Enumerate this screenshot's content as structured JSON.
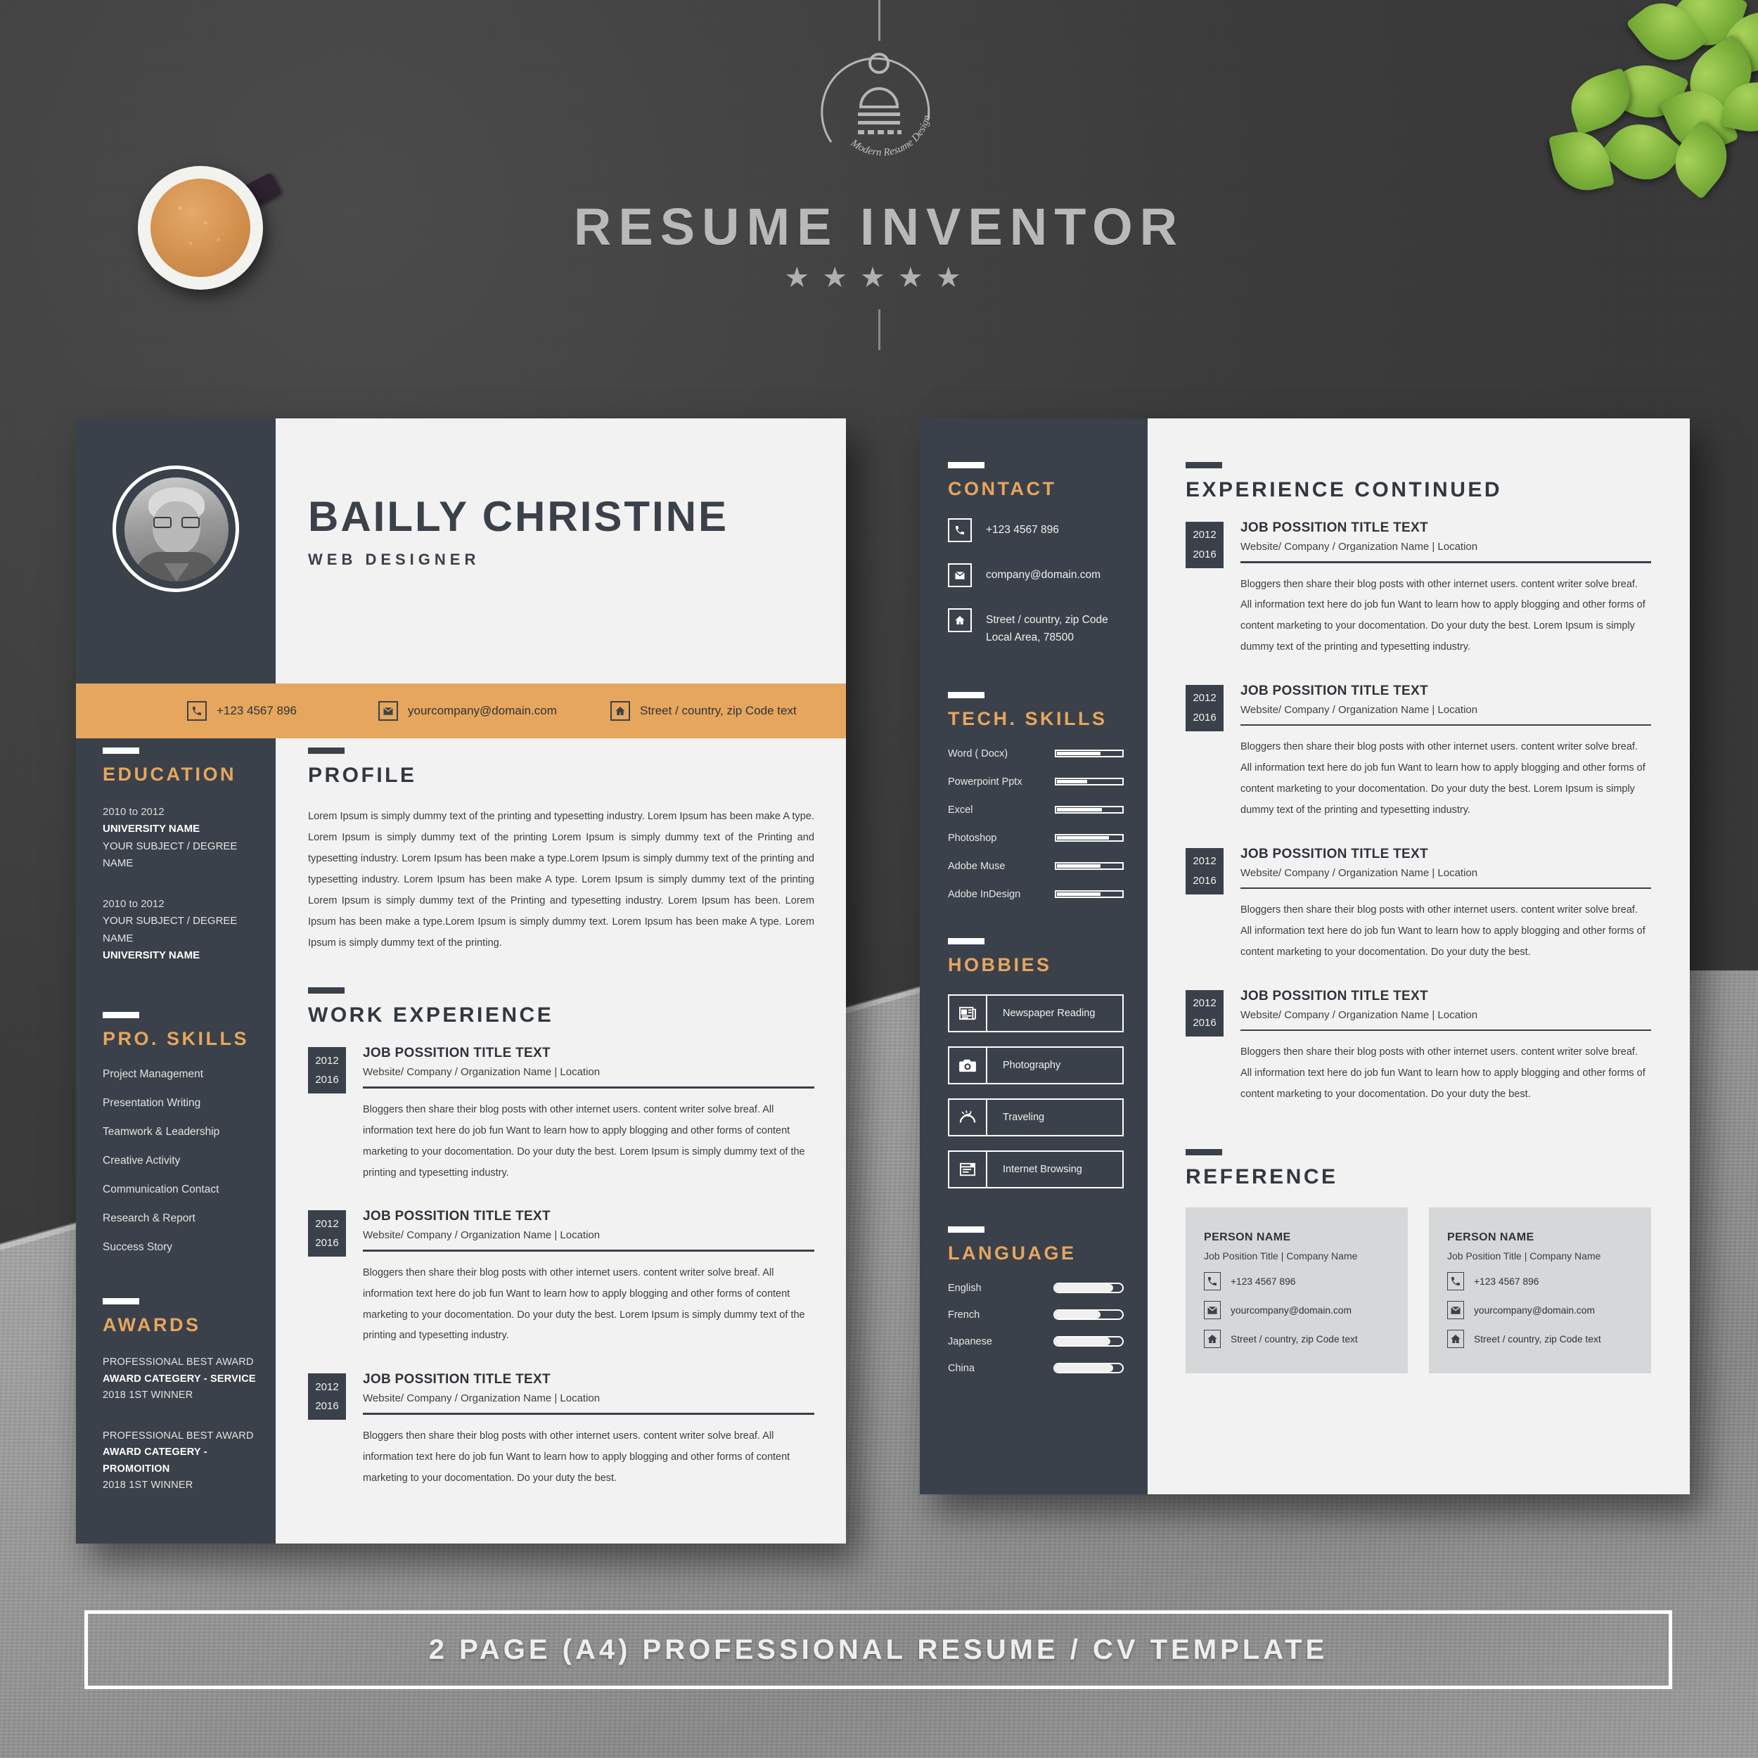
{
  "brand": {
    "title": "RESUME INVENTOR",
    "stars": "★★★★★",
    "logo_caption": "Modern Resume Design"
  },
  "banner": {
    "text": "2 PAGE (A4) PROFESSIONAL RESUME / CV TEMPLATE"
  },
  "page_left": {
    "name": "BAILLY CHRISTINE",
    "role": "WEB DESIGNER",
    "topbar": [
      {
        "icon": "phone-icon",
        "text": "+123 4567 896"
      },
      {
        "icon": "envelope-icon",
        "text": "yourcompany@domain.com"
      },
      {
        "icon": "home-icon",
        "text": "Street / country, zip Code text"
      }
    ],
    "education": {
      "heading": "EDUCATION",
      "items": [
        {
          "years": "2010 to 2012",
          "line2": "UNIVERSITY NAME",
          "line3": "YOUR SUBJECT / DEGREE NAME",
          "bold_first": true
        },
        {
          "years": "2010 to 2012",
          "line2": "YOUR SUBJECT / DEGREE NAME",
          "line3": "UNIVERSITY NAME",
          "bold_first": false
        }
      ]
    },
    "pro_skills": {
      "heading": "PRO. SKILLS",
      "items": [
        "Project Management",
        "Presentation Writing",
        "Teamwork & Leadership",
        "Creative Activity",
        "Communication Contact",
        "Research & Report",
        "Success Story"
      ]
    },
    "awards": {
      "heading": "AWARDS",
      "items": [
        {
          "line1": "PROFESSIONAL BEST AWARD",
          "line2": "AWARD CATEGERY - SERVICE",
          "line3": "2018 1ST WINNER"
        },
        {
          "line1": "PROFESSIONAL BEST AWARD",
          "line2": "AWARD CATEGERY - PROMOITION",
          "line3": "2018 1ST WINNER"
        }
      ]
    },
    "profile": {
      "heading": "PROFILE",
      "text": "Lorem Ipsum is simply dummy text of the printing and typesetting industry. Lorem Ipsum has been make A type. Lorem Ipsum is simply dummy text of the printing Lorem Ipsum is simply dummy text of the Printing and typesetting industry. Lorem Ipsum has been make a type.Lorem Ipsum is simply dummy text of the printing and typesetting industry. Lorem Ipsum has been make A type. Lorem Ipsum is simply dummy text of the printing Lorem Ipsum is simply dummy text of the Printing and typesetting industry. Lorem Ipsum has been. Lorem Ipsum has been make a type.Lorem Ipsum is simply dummy text. Lorem Ipsum has been make A type. Lorem Ipsum is simply dummy text of the printing."
    },
    "work_experience": {
      "heading": "WORK EXPERIENCE",
      "items": [
        {
          "year_from": "2012",
          "year_to": "2016",
          "title": "JOB POSSITION TITLE TEXT",
          "meta": "Website/ Company / Organization Name  |  Location",
          "desc": "Bloggers then share their blog posts with other internet users. content writer solve breaf. All information text here do job fun   Want to learn how to apply blogging and other forms of content marketing to your docomentation. Do your duty the best. Lorem Ipsum is simply dummy text of the printing and typesetting industry."
        },
        {
          "year_from": "2012",
          "year_to": "2016",
          "title": "JOB POSSITION TITLE TEXT",
          "meta": "Website/ Company / Organization Name  |  Location",
          "desc": "Bloggers then share their blog posts with other internet users. content writer solve breaf. All information text here do job fun   Want to learn how to apply blogging and other forms of content marketing to your docomentation. Do your duty the best. Lorem Ipsum is simply dummy text of the printing and typesetting industry."
        },
        {
          "year_from": "2012",
          "year_to": "2016",
          "title": "JOB POSSITION TITLE TEXT",
          "meta": "Website/ Company / Organization Name  |  Location",
          "desc": "Bloggers then share their blog posts with other internet users. content writer solve breaf. All information text here do job fun   Want to learn how to apply blogging and other forms of content marketing to your docomentation. Do your duty the best."
        }
      ]
    }
  },
  "page_right": {
    "contact": {
      "heading": "CONTACT",
      "items": [
        {
          "icon": "phone-icon",
          "text": "+123 4567 896"
        },
        {
          "icon": "envelope-icon",
          "text": "company@domain.com"
        },
        {
          "icon": "home-icon",
          "text": "Street / country, zip Code\nLocal Area, 78500"
        }
      ]
    },
    "tech_skills": {
      "heading": "TECH. SKILLS",
      "items": [
        {
          "label": "Word ( Docx)",
          "level": 72
        },
        {
          "label": "Powerpoint Pptx",
          "level": 50
        },
        {
          "label": "Excel",
          "level": 74
        },
        {
          "label": "Photoshop",
          "level": 85
        },
        {
          "label": "Adobe Muse",
          "level": 72
        },
        {
          "label": "Adobe InDesign",
          "level": 72
        }
      ]
    },
    "hobbies": {
      "heading": "HOBBIES",
      "items": [
        {
          "icon": "newspaper-icon",
          "label": "Newspaper Reading"
        },
        {
          "icon": "camera-icon",
          "label": "Photography"
        },
        {
          "icon": "airplane-icon",
          "label": "Traveling"
        },
        {
          "icon": "browser-icon",
          "label": "Internet Browsing"
        }
      ]
    },
    "language": {
      "heading": "LANGUAGE",
      "items": [
        {
          "label": "English",
          "level": 86
        },
        {
          "label": "French",
          "level": 68
        },
        {
          "label": "Japanese",
          "level": 82
        },
        {
          "label": "China",
          "level": 86
        }
      ]
    },
    "experience_continued": {
      "heading": "EXPERIENCE CONTINUED",
      "items": [
        {
          "year_from": "2012",
          "year_to": "2016",
          "title": "JOB POSSITION TITLE TEXT",
          "meta": "Website/ Company / Organization Name  |  Location",
          "desc": "Bloggers then share their blog posts with other internet users. content writer solve breaf. All information text here do job fun   Want to learn how to apply blogging and other forms of content marketing to your docomentation. Do your duty the best. Lorem Ipsum is simply dummy text of the printing and typesetting industry."
        },
        {
          "year_from": "2012",
          "year_to": "2016",
          "title": "JOB POSSITION TITLE TEXT",
          "meta": "Website/ Company / Organization Name  |  Location",
          "desc": "Bloggers then share their blog posts with other internet users. content writer solve breaf. All information text here do job fun   Want to learn how to apply blogging and other forms of content marketing to your docomentation. Do your duty the best. Lorem Ipsum is simply dummy text of the printing and typesetting industry."
        },
        {
          "year_from": "2012",
          "year_to": "2016",
          "title": "JOB POSSITION TITLE TEXT",
          "meta": "Website/ Company / Organization Name  |  Location",
          "desc": "Bloggers then share their blog posts with other internet users. content writer solve breaf. All information text here do job fun   Want to learn how to apply blogging and other forms of content marketing to your docomentation. Do your duty the best."
        },
        {
          "year_from": "2012",
          "year_to": "2016",
          "title": "JOB POSSITION TITLE TEXT",
          "meta": "Website/ Company / Organization Name  |  Location",
          "desc": "Bloggers then share their blog posts with other internet users. content writer solve breaf. All information text here do job fun   Want to learn how to apply blogging and other forms of content marketing to your docomentation. Do your duty the best."
        }
      ]
    },
    "reference": {
      "heading": "REFERENCE",
      "items": [
        {
          "name": "PERSON NAME",
          "sub": "Job Position Title  |  Company Name",
          "phone": "+123 4567 896",
          "email": "yourcompany@domain.com",
          "address": "Street / country, zip Code text"
        },
        {
          "name": "PERSON NAME",
          "sub": "Job Position Title  |  Company Name",
          "phone": "+123 4567 896",
          "email": "yourcompany@domain.com",
          "address": "Street / country, zip Code text"
        }
      ]
    }
  },
  "colors": {
    "navy": "#3b414a",
    "orange": "#e6a65e",
    "paper": "#f2f2f2",
    "ref_card": "#d6d7d9"
  }
}
